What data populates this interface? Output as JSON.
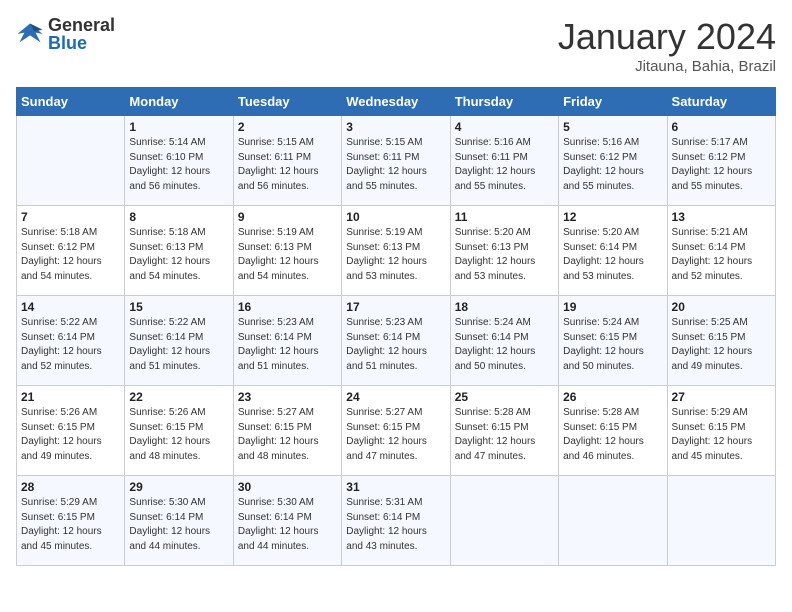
{
  "header": {
    "logo_general": "General",
    "logo_blue": "Blue",
    "month_title": "January 2024",
    "subtitle": "Jitauna, Bahia, Brazil"
  },
  "days_of_week": [
    "Sunday",
    "Monday",
    "Tuesday",
    "Wednesday",
    "Thursday",
    "Friday",
    "Saturday"
  ],
  "weeks": [
    [
      {
        "day": "",
        "sunrise": "",
        "sunset": "",
        "daylight": ""
      },
      {
        "day": "1",
        "sunrise": "Sunrise: 5:14 AM",
        "sunset": "Sunset: 6:10 PM",
        "daylight": "Daylight: 12 hours and 56 minutes."
      },
      {
        "day": "2",
        "sunrise": "Sunrise: 5:15 AM",
        "sunset": "Sunset: 6:11 PM",
        "daylight": "Daylight: 12 hours and 56 minutes."
      },
      {
        "day": "3",
        "sunrise": "Sunrise: 5:15 AM",
        "sunset": "Sunset: 6:11 PM",
        "daylight": "Daylight: 12 hours and 55 minutes."
      },
      {
        "day": "4",
        "sunrise": "Sunrise: 5:16 AM",
        "sunset": "Sunset: 6:11 PM",
        "daylight": "Daylight: 12 hours and 55 minutes."
      },
      {
        "day": "5",
        "sunrise": "Sunrise: 5:16 AM",
        "sunset": "Sunset: 6:12 PM",
        "daylight": "Daylight: 12 hours and 55 minutes."
      },
      {
        "day": "6",
        "sunrise": "Sunrise: 5:17 AM",
        "sunset": "Sunset: 6:12 PM",
        "daylight": "Daylight: 12 hours and 55 minutes."
      }
    ],
    [
      {
        "day": "7",
        "sunrise": "Sunrise: 5:18 AM",
        "sunset": "Sunset: 6:12 PM",
        "daylight": "Daylight: 12 hours and 54 minutes."
      },
      {
        "day": "8",
        "sunrise": "Sunrise: 5:18 AM",
        "sunset": "Sunset: 6:13 PM",
        "daylight": "Daylight: 12 hours and 54 minutes."
      },
      {
        "day": "9",
        "sunrise": "Sunrise: 5:19 AM",
        "sunset": "Sunset: 6:13 PM",
        "daylight": "Daylight: 12 hours and 54 minutes."
      },
      {
        "day": "10",
        "sunrise": "Sunrise: 5:19 AM",
        "sunset": "Sunset: 6:13 PM",
        "daylight": "Daylight: 12 hours and 53 minutes."
      },
      {
        "day": "11",
        "sunrise": "Sunrise: 5:20 AM",
        "sunset": "Sunset: 6:13 PM",
        "daylight": "Daylight: 12 hours and 53 minutes."
      },
      {
        "day": "12",
        "sunrise": "Sunrise: 5:20 AM",
        "sunset": "Sunset: 6:14 PM",
        "daylight": "Daylight: 12 hours and 53 minutes."
      },
      {
        "day": "13",
        "sunrise": "Sunrise: 5:21 AM",
        "sunset": "Sunset: 6:14 PM",
        "daylight": "Daylight: 12 hours and 52 minutes."
      }
    ],
    [
      {
        "day": "14",
        "sunrise": "Sunrise: 5:22 AM",
        "sunset": "Sunset: 6:14 PM",
        "daylight": "Daylight: 12 hours and 52 minutes."
      },
      {
        "day": "15",
        "sunrise": "Sunrise: 5:22 AM",
        "sunset": "Sunset: 6:14 PM",
        "daylight": "Daylight: 12 hours and 51 minutes."
      },
      {
        "day": "16",
        "sunrise": "Sunrise: 5:23 AM",
        "sunset": "Sunset: 6:14 PM",
        "daylight": "Daylight: 12 hours and 51 minutes."
      },
      {
        "day": "17",
        "sunrise": "Sunrise: 5:23 AM",
        "sunset": "Sunset: 6:14 PM",
        "daylight": "Daylight: 12 hours and 51 minutes."
      },
      {
        "day": "18",
        "sunrise": "Sunrise: 5:24 AM",
        "sunset": "Sunset: 6:14 PM",
        "daylight": "Daylight: 12 hours and 50 minutes."
      },
      {
        "day": "19",
        "sunrise": "Sunrise: 5:24 AM",
        "sunset": "Sunset: 6:15 PM",
        "daylight": "Daylight: 12 hours and 50 minutes."
      },
      {
        "day": "20",
        "sunrise": "Sunrise: 5:25 AM",
        "sunset": "Sunset: 6:15 PM",
        "daylight": "Daylight: 12 hours and 49 minutes."
      }
    ],
    [
      {
        "day": "21",
        "sunrise": "Sunrise: 5:26 AM",
        "sunset": "Sunset: 6:15 PM",
        "daylight": "Daylight: 12 hours and 49 minutes."
      },
      {
        "day": "22",
        "sunrise": "Sunrise: 5:26 AM",
        "sunset": "Sunset: 6:15 PM",
        "daylight": "Daylight: 12 hours and 48 minutes."
      },
      {
        "day": "23",
        "sunrise": "Sunrise: 5:27 AM",
        "sunset": "Sunset: 6:15 PM",
        "daylight": "Daylight: 12 hours and 48 minutes."
      },
      {
        "day": "24",
        "sunrise": "Sunrise: 5:27 AM",
        "sunset": "Sunset: 6:15 PM",
        "daylight": "Daylight: 12 hours and 47 minutes."
      },
      {
        "day": "25",
        "sunrise": "Sunrise: 5:28 AM",
        "sunset": "Sunset: 6:15 PM",
        "daylight": "Daylight: 12 hours and 47 minutes."
      },
      {
        "day": "26",
        "sunrise": "Sunrise: 5:28 AM",
        "sunset": "Sunset: 6:15 PM",
        "daylight": "Daylight: 12 hours and 46 minutes."
      },
      {
        "day": "27",
        "sunrise": "Sunrise: 5:29 AM",
        "sunset": "Sunset: 6:15 PM",
        "daylight": "Daylight: 12 hours and 45 minutes."
      }
    ],
    [
      {
        "day": "28",
        "sunrise": "Sunrise: 5:29 AM",
        "sunset": "Sunset: 6:15 PM",
        "daylight": "Daylight: 12 hours and 45 minutes."
      },
      {
        "day": "29",
        "sunrise": "Sunrise: 5:30 AM",
        "sunset": "Sunset: 6:14 PM",
        "daylight": "Daylight: 12 hours and 44 minutes."
      },
      {
        "day": "30",
        "sunrise": "Sunrise: 5:30 AM",
        "sunset": "Sunset: 6:14 PM",
        "daylight": "Daylight: 12 hours and 44 minutes."
      },
      {
        "day": "31",
        "sunrise": "Sunrise: 5:31 AM",
        "sunset": "Sunset: 6:14 PM",
        "daylight": "Daylight: 12 hours and 43 minutes."
      },
      {
        "day": "",
        "sunrise": "",
        "sunset": "",
        "daylight": ""
      },
      {
        "day": "",
        "sunrise": "",
        "sunset": "",
        "daylight": ""
      },
      {
        "day": "",
        "sunrise": "",
        "sunset": "",
        "daylight": ""
      }
    ]
  ]
}
